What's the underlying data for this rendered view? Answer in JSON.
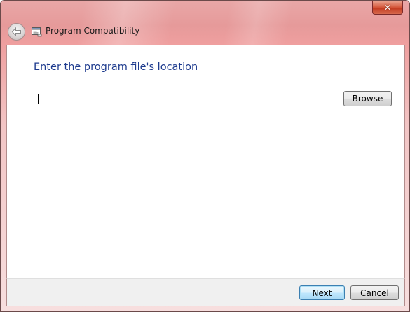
{
  "window": {
    "title": "Program Compatibility",
    "close_symbol": "✕",
    "accent_color": "#e69a9a"
  },
  "nav": {
    "back_icon": "back-arrow-icon",
    "app_icon": "program-compatibility-icon"
  },
  "main": {
    "heading": "Enter the program file's location",
    "path_input": {
      "value": "",
      "placeholder": ""
    },
    "browse_label": "Browse"
  },
  "footer": {
    "next_label": "Next",
    "cancel_label": "Cancel"
  }
}
